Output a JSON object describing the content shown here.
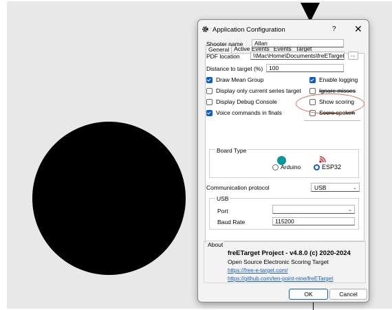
{
  "window": {
    "title": "Application Configuration",
    "help": "?",
    "close": "✕"
  },
  "tabs": [
    "General",
    "Active Events",
    "Events",
    "Target"
  ],
  "general": {
    "shooter_name_label": "Shooter name",
    "shooter_name_value": "Allan",
    "pdf_location_label": "PDF location",
    "pdf_location_value": "\\\\Mac\\Home\\Documents\\freETarget\\",
    "browse_label": "...",
    "distance_label": "Distance to target (%)",
    "distance_value": "100"
  },
  "checkboxes": {
    "draw_mean_group": {
      "label": "Draw Mean Group",
      "checked": true
    },
    "display_current_series": {
      "label": "Display only current series target",
      "checked": false
    },
    "display_debug_console": {
      "label": "Display Debug Console",
      "checked": false
    },
    "voice_commands": {
      "label": "Voice commands in finals",
      "checked": true
    },
    "enable_logging": {
      "label": "Enable logging",
      "checked": true
    },
    "ignore_misses": {
      "label": "Ignore misses",
      "checked": false
    },
    "show_scoring": {
      "label": "Show scoring",
      "checked": false
    },
    "score_spoken": {
      "label": "Score spoken",
      "checked": false
    }
  },
  "board_type": {
    "title": "Board Type",
    "options": [
      {
        "label": "Arduino",
        "selected": false
      },
      {
        "label": "ESP32",
        "selected": true
      }
    ]
  },
  "communication": {
    "label": "Communication protocol",
    "value": "USB",
    "group_title": "USB",
    "port_label": "Port",
    "port_value": "",
    "baud_label": "Baud Rate",
    "baud_value": "115200"
  },
  "about": {
    "label": "About",
    "project": "freETarget Project  -  v4.8.0  (c) 2020-2024",
    "description": "Open Source Electronic Scoring Target",
    "link1": "https://free-e-target.com/",
    "link2": "https://github.com/ten-point-nine/freETarget"
  },
  "buttons": {
    "ok": "OK",
    "cancel": "Cancel"
  },
  "colors": {
    "accent": "#0b5cc8",
    "annotation": "#e36b4f",
    "arduino": "#00979d",
    "esp32": "#e52420"
  }
}
